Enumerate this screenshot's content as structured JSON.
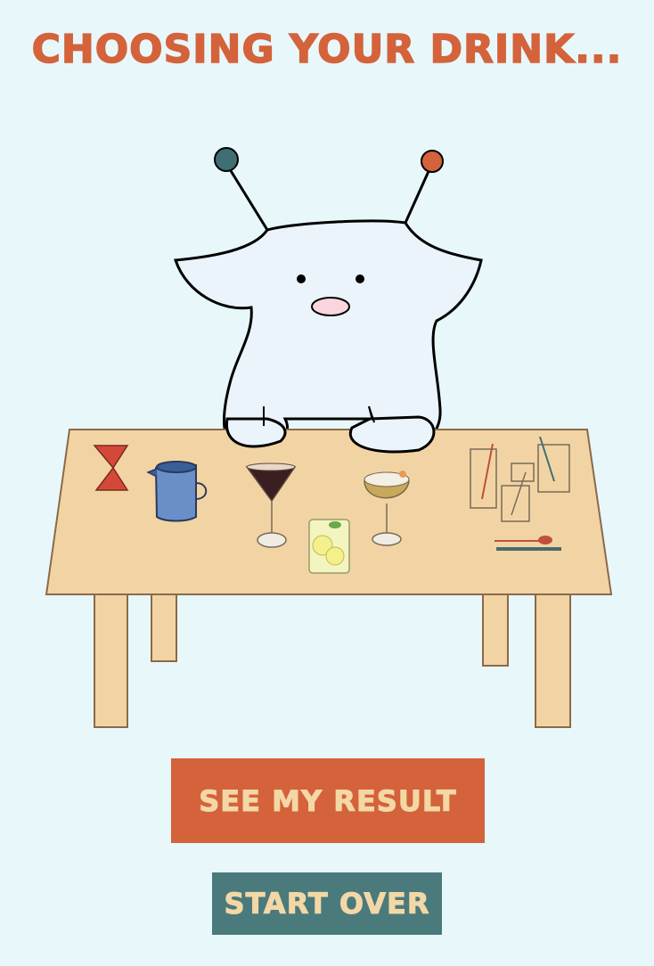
{
  "page": {
    "title": "CHOOSING YOUR DRINK..."
  },
  "buttons": {
    "see_result_label": "SEE MY RESULT",
    "start_over_label": "START OVER"
  },
  "colors": {
    "background": "#e8f7fa",
    "accent_orange": "#d4623a",
    "accent_teal": "#4a7a7c",
    "button_text": "#f3d8a6",
    "table": "#f2d4a4"
  },
  "illustration": {
    "character": "creature-with-antennae",
    "items": [
      "jigger-icon",
      "blue-pitcher-icon",
      "espresso-martini-icon",
      "lemon-highball-icon",
      "sour-coupe-icon",
      "glasses-and-straws-icon",
      "bar-spoon-icon"
    ]
  }
}
